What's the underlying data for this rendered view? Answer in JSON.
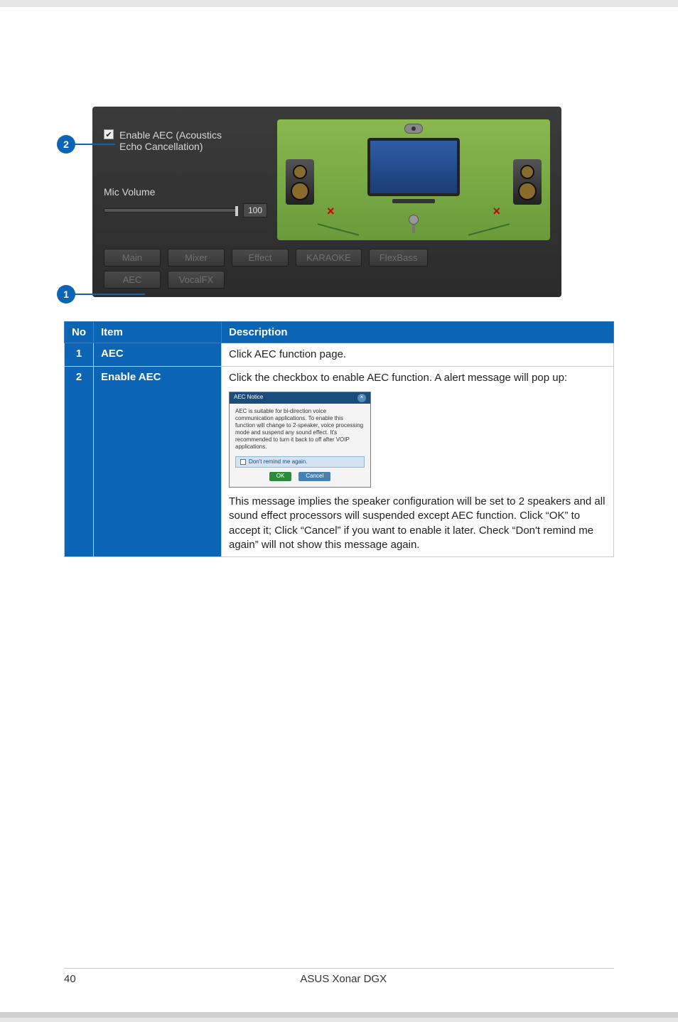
{
  "callouts": {
    "one": "1",
    "two": "2"
  },
  "panel": {
    "enable_label_line1": "Enable AEC (Acoustics",
    "enable_label_line2": "Echo Cancellation)",
    "mic_label": "Mic Volume",
    "mic_value": "100"
  },
  "tabs": {
    "row1": [
      "Main",
      "Mixer",
      "Effect",
      "KARAOKE",
      "FlexBass"
    ],
    "row2": [
      "AEC",
      "VocalFX"
    ]
  },
  "table": {
    "headers": {
      "no": "No",
      "item": "Item",
      "desc": "Description"
    },
    "rows": [
      {
        "no": "1",
        "item": "AEC",
        "desc": "Click AEC function page."
      },
      {
        "no": "2",
        "item": "Enable AEC",
        "desc_top": "Click the checkbox to enable AEC function. A alert message will pop up:",
        "dialog": {
          "title": "AEC Notice",
          "body": "AEC is suitable for bi-direction voice communication applications. To enable this function will change to 2-speaker, voice processing mode and suspend any sound effect. It's recommended to turn it back to off after VOIP applications.",
          "remind": "Don't remind me again.",
          "ok": "OK",
          "cancel": "Cancel"
        },
        "desc_bottom": "This message implies the speaker configuration will be set to 2 speakers and all sound effect processors will suspended except AEC function. Click “OK” to accept it; Click “Cancel” if you want to enable it later. Check “Don't remind me again” will not show this message again."
      }
    ]
  },
  "footer": {
    "page": "40",
    "product": "ASUS Xonar DGX"
  }
}
